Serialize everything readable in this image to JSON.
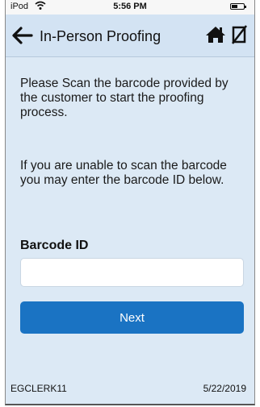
{
  "status_bar": {
    "carrier": "iPod",
    "time": "5:56 PM",
    "battery_level": 0.5
  },
  "nav": {
    "title": "In-Person Proofing"
  },
  "instructions": {
    "scan_text": "Please Scan the barcode provided by the customer to start the proofing process.",
    "manual_text": "If you are unable to scan the barcode you may enter the barcode ID below."
  },
  "form": {
    "barcode_label": "Barcode ID",
    "barcode_value": "",
    "next_label": "Next"
  },
  "footer": {
    "user": "EGCLERK11",
    "date": "5/22/2019"
  },
  "colors": {
    "nav_bg": "#d3e3f3",
    "page_bg": "#dce9f5",
    "accent": "#1a73c3"
  }
}
